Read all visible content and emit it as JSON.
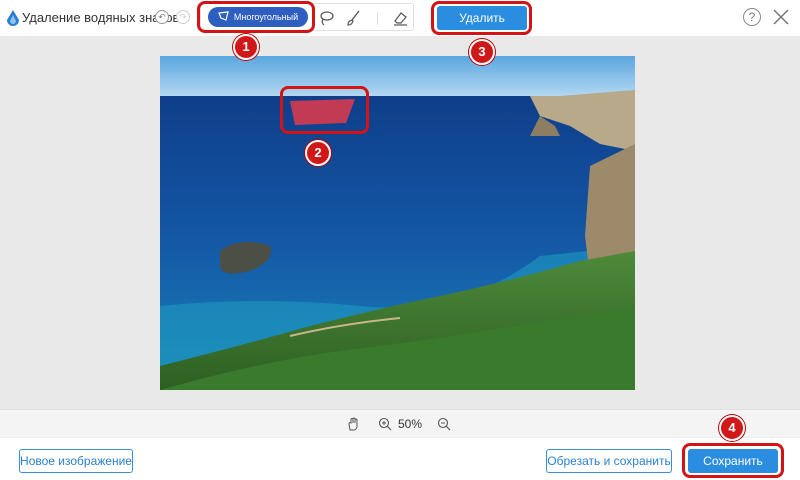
{
  "header": {
    "title": "Удаление водяных знаков",
    "undo_icon": "undo-icon",
    "redo_icon": "redo-icon",
    "help_label": "?",
    "close_icon": "close-icon"
  },
  "tools": {
    "polygon_label": "Многоугольный",
    "polygon_icon": "polygon-icon",
    "lasso_icon": "lasso-icon",
    "brush_icon": "brush-icon",
    "eraser_icon": "eraser-icon"
  },
  "remove_button": "Удалить",
  "zoom": {
    "hand_icon": "hand-icon",
    "zoom_in_icon": "zoom-in-icon",
    "zoom_out_icon": "zoom-out-icon",
    "value": "50%"
  },
  "footer": {
    "new_image": "Новое изображение",
    "crop_save": "Обрезать и сохранить",
    "save": "Сохранить"
  },
  "badges": [
    "1",
    "2",
    "3",
    "4"
  ],
  "colors": {
    "accent": "#2b8de0",
    "selected_tool": "#2e5fc0",
    "highlight": "#d41414",
    "selection": "#e23a4a"
  }
}
